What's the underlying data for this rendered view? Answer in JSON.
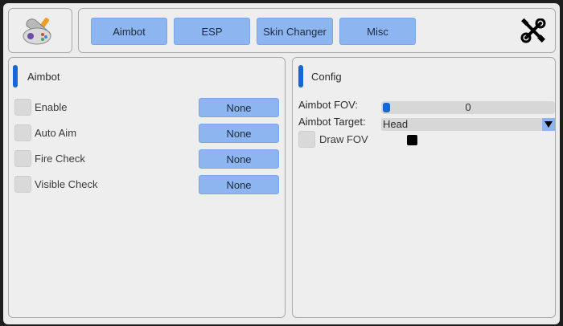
{
  "header": {
    "logo_icon": "gamepad-wrench-icon",
    "tabs": [
      {
        "label": "Aimbot"
      },
      {
        "label": "ESP"
      },
      {
        "label": "Skin Changer"
      },
      {
        "label": "Misc"
      }
    ],
    "tools_icon": "wrench-screwdriver-icon"
  },
  "aimbot_panel": {
    "title": "Aimbot",
    "options": [
      {
        "label": "Enable",
        "key": "None",
        "checked": false
      },
      {
        "label": "Auto Aim",
        "key": "None",
        "checked": false
      },
      {
        "label": "Fire Check",
        "key": "None",
        "checked": false
      },
      {
        "label": "Visible Check",
        "key": "None",
        "checked": false
      }
    ]
  },
  "config_panel": {
    "title": "Config",
    "fov": {
      "label": "Aimbot FOV:",
      "value": "0"
    },
    "target": {
      "label": "Aimbot Target:",
      "value": "Head"
    },
    "draw_fov": {
      "label": "Draw FOV",
      "checked": false,
      "color": "#000000"
    }
  },
  "colors": {
    "accent": "#1766d6",
    "button": "#8db6f0",
    "panel": "#eeeeee"
  }
}
